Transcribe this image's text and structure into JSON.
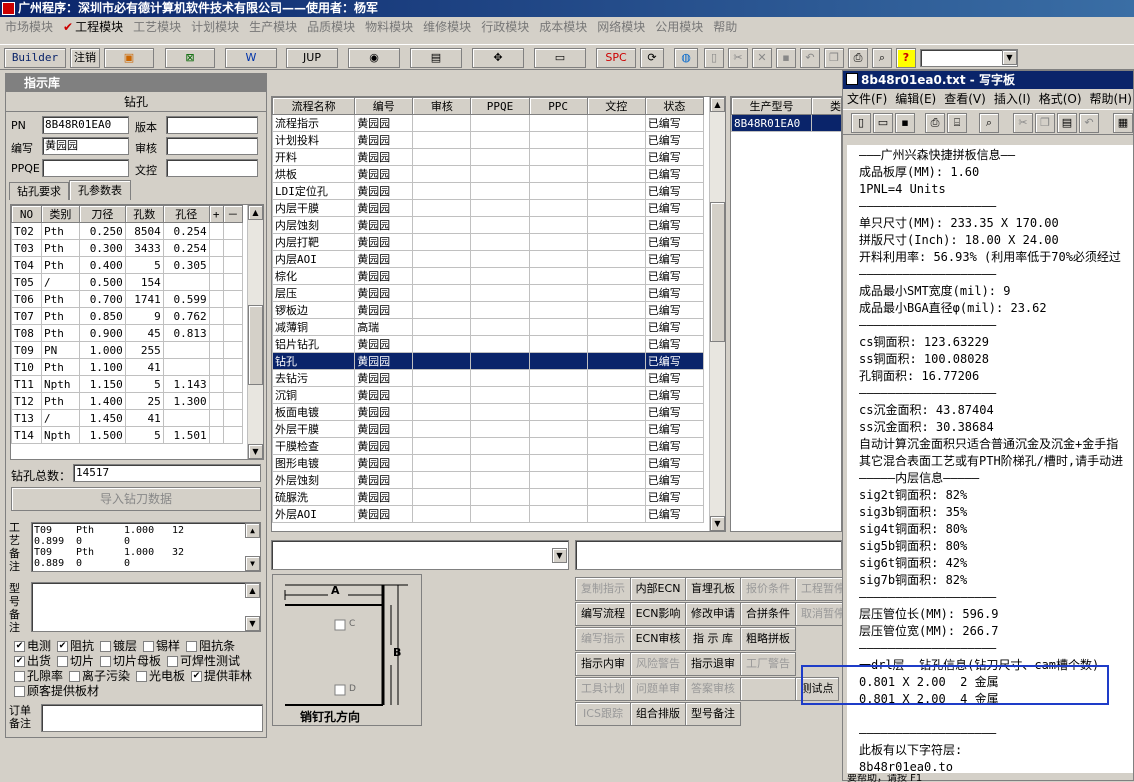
{
  "app": {
    "title": "广州程序：深圳市必有德计算机软件技术有限公司——使用者：杨军"
  },
  "menu": [
    {
      "label": "市场模块",
      "active": false
    },
    {
      "label": "工程模块",
      "active": true
    },
    {
      "label": "工艺模块",
      "active": false
    },
    {
      "label": "计划模块",
      "active": false
    },
    {
      "label": "生产模块",
      "active": false
    },
    {
      "label": "品质模块",
      "active": false
    },
    {
      "label": "物料模块",
      "active": false
    },
    {
      "label": "维修模块",
      "active": false
    },
    {
      "label": "行政模块",
      "active": false
    },
    {
      "label": "成本模块",
      "active": false
    },
    {
      "label": "网络模块",
      "active": false
    },
    {
      "label": "公用模块",
      "active": false
    },
    {
      "label": "帮助",
      "active": false
    }
  ],
  "toolbar": {
    "builder": "Builder",
    "logout": "注销",
    "jup": "JUP",
    "spc": "SPC"
  },
  "left": {
    "title": "指示库",
    "section": "钻孔",
    "pn_label": "PN",
    "pn": "8B48R01EA0",
    "version_label": "版本",
    "version": "",
    "editor_label": "编写",
    "editor": "黄园园",
    "review_label": "审核",
    "review": "",
    "ppqe_label": "PPQE",
    "ppqe": "",
    "wenkong_label": "文控",
    "wenkong": "",
    "tabs": [
      "钻孔要求",
      "孔参数表"
    ],
    "drill_headers": [
      "NO",
      "类别",
      "刀径",
      "孔数",
      "孔径",
      "+",
      "－"
    ],
    "drill_rows": [
      [
        "T02",
        "Pth",
        "0.250",
        "8504",
        "0.254"
      ],
      [
        "T03",
        "Pth",
        "0.300",
        "3433",
        "0.254"
      ],
      [
        "T04",
        "Pth",
        "0.400",
        "5",
        "0.305"
      ],
      [
        "T05",
        "/",
        "0.500",
        "154",
        ""
      ],
      [
        "T06",
        "Pth",
        "0.700",
        "1741",
        "0.599"
      ],
      [
        "T07",
        "Pth",
        "0.850",
        "9",
        "0.762"
      ],
      [
        "T08",
        "Pth",
        "0.900",
        "45",
        "0.813"
      ],
      [
        "T09",
        "PN",
        "1.000",
        "255",
        ""
      ],
      [
        "T10",
        "Pth",
        "1.100",
        "41",
        ""
      ],
      [
        "T11",
        "Npth",
        "1.150",
        "5",
        "1.143"
      ],
      [
        "T12",
        "Pth",
        "1.400",
        "25",
        "1.300"
      ],
      [
        "T13",
        "/",
        "1.450",
        "41",
        ""
      ],
      [
        "T14",
        "Npth",
        "1.500",
        "5",
        "1.501"
      ]
    ],
    "total_label": "钻孔总数：",
    "total": "14517",
    "import_btn": "导入钻刀数据",
    "note_label": "工艺备注",
    "note_lines": [
      [
        "T09",
        "Pth",
        "1.000",
        "12"
      ],
      [
        "0.899",
        "0",
        "0",
        ""
      ],
      [
        "T09",
        "Pth",
        "1.000",
        "32"
      ],
      [
        "0.889",
        "0",
        "0",
        ""
      ]
    ],
    "model_note_label": "型号备注",
    "checks": [
      [
        {
          "label": "电测",
          "checked": true
        },
        {
          "label": "阻抗",
          "checked": true
        },
        {
          "label": "镀层",
          "checked": false
        },
        {
          "label": "锡样",
          "checked": false
        },
        {
          "label": "阻抗条",
          "checked": false
        }
      ],
      [
        {
          "label": "出货",
          "checked": true
        },
        {
          "label": "切片",
          "checked": false
        },
        {
          "label": "切片母板",
          "checked": false
        },
        {
          "label": "可焊性测试",
          "checked": false
        }
      ],
      [
        {
          "label": "孔隙率",
          "checked": false
        },
        {
          "label": "离子污染",
          "checked": false
        },
        {
          "label": "光电板",
          "checked": false
        },
        {
          "label": "提供菲林",
          "checked": true
        }
      ],
      [
        {
          "label": "顾客提供板材",
          "checked": false
        }
      ]
    ],
    "order_note_label": "订单备注"
  },
  "process": {
    "headers": [
      "流程名称",
      "编号",
      "审核",
      "PPQE",
      "PPC",
      "文控",
      "状态"
    ],
    "rows": [
      [
        "流程指示",
        "黄园园",
        "",
        "",
        "",
        "",
        "已编写"
      ],
      [
        "计划投料",
        "黄园园",
        "",
        "",
        "",
        "",
        "已编写"
      ],
      [
        "开料",
        "黄园园",
        "",
        "",
        "",
        "",
        "已编写"
      ],
      [
        "烘板",
        "黄园园",
        "",
        "",
        "",
        "",
        "已编写"
      ],
      [
        "LDI定位孔",
        "黄园园",
        "",
        "",
        "",
        "",
        "已编写"
      ],
      [
        "内层干膜",
        "黄园园",
        "",
        "",
        "",
        "",
        "已编写"
      ],
      [
        "内层蚀刻",
        "黄园园",
        "",
        "",
        "",
        "",
        "已编写"
      ],
      [
        "内层打靶",
        "黄园园",
        "",
        "",
        "",
        "",
        "已编写"
      ],
      [
        "内层AOI",
        "黄园园",
        "",
        "",
        "",
        "",
        "已编写"
      ],
      [
        "棕化",
        "黄园园",
        "",
        "",
        "",
        "",
        "已编写"
      ],
      [
        "层压",
        "黄园园",
        "",
        "",
        "",
        "",
        "已编写"
      ],
      [
        "锣板边",
        "黄园园",
        "",
        "",
        "",
        "",
        "已编写"
      ],
      [
        "减薄铜",
        "高瑞",
        "",
        "",
        "",
        "",
        "已编写"
      ],
      [
        "铝片钻孔",
        "黄园园",
        "",
        "",
        "",
        "",
        "已编写"
      ],
      [
        "钻孔",
        "黄园园",
        "",
        "",
        "",
        "",
        "已编写"
      ],
      [
        "去钻污",
        "黄园园",
        "",
        "",
        "",
        "",
        "已编写"
      ],
      [
        "沉铜",
        "黄园园",
        "",
        "",
        "",
        "",
        "已编写"
      ],
      [
        "板面电镀",
        "黄园园",
        "",
        "",
        "",
        "",
        "已编写"
      ],
      [
        "外层干膜",
        "黄园园",
        "",
        "",
        "",
        "",
        "已编写"
      ],
      [
        "干膜检查",
        "黄园园",
        "",
        "",
        "",
        "",
        "已编写"
      ],
      [
        "图形电镀",
        "黄园园",
        "",
        "",
        "",
        "",
        "已编写"
      ],
      [
        "外层蚀刻",
        "黄园园",
        "",
        "",
        "",
        "",
        "已编写"
      ],
      [
        "硫脲洗",
        "黄园园",
        "",
        "",
        "",
        "",
        "已编写"
      ],
      [
        "外层AOI",
        "黄园园",
        "",
        "",
        "",
        "",
        "已编写"
      ]
    ],
    "selected": 14
  },
  "model": {
    "headers": [
      "生产型号",
      "类型"
    ],
    "value": "8B48R01EA0"
  },
  "pin": {
    "a": "A",
    "b": "B",
    "c": "C",
    "d": "D",
    "label": "销钉孔方向"
  },
  "buttons": [
    [
      {
        "label": "复制指示",
        "enabled": false
      },
      {
        "label": "内部ECN",
        "enabled": true
      },
      {
        "label": "盲埋孔板",
        "enabled": true
      },
      {
        "label": "报价条件",
        "enabled": false
      },
      {
        "label": "工程暂停",
        "enabled": false
      }
    ],
    [
      {
        "label": "编写流程",
        "enabled": true
      },
      {
        "label": "ECN影响",
        "enabled": true
      },
      {
        "label": "修改申请",
        "enabled": true
      },
      {
        "label": "合拼条件",
        "enabled": true
      },
      {
        "label": "取消暂停",
        "enabled": false
      }
    ],
    [
      {
        "label": "编写指示",
        "enabled": false
      },
      {
        "label": "ECN审核",
        "enabled": true
      },
      {
        "label": "指 示 库",
        "enabled": true
      },
      {
        "label": "粗略拼板",
        "enabled": true
      }
    ],
    [
      {
        "label": "指示内审",
        "enabled": true
      },
      {
        "label": "风险警告",
        "enabled": false
      },
      {
        "label": "指示退审",
        "enabled": true
      },
      {
        "label": "工厂警告",
        "enabled": false
      }
    ],
    [
      {
        "label": "工具计划",
        "enabled": false
      },
      {
        "label": "问题单审核",
        "enabled": false
      },
      {
        "label": "答案审核",
        "enabled": false
      },
      {
        "label": "",
        "enabled": false
      },
      {
        "label": "测试点",
        "enabled": true
      }
    ],
    [
      {
        "label": "ICS跟踪",
        "enabled": false
      },
      {
        "label": "组合排版",
        "enabled": true
      },
      {
        "label": "型号备注",
        "enabled": true
      }
    ]
  ],
  "notepad": {
    "title": "8b48r01ea0.txt - 写字板",
    "menu": [
      "文件(F)",
      "编辑(E)",
      "查看(V)",
      "插入(I)",
      "格式(O)",
      "帮助(H)"
    ],
    "lines": [
      "———广州兴森快捷拼板信息——",
      "成品板厚(MM): 1.60",
      "1PNL=4 Units",
      "———————————————————",
      "单只尺寸(MM): 233.35 X 170.00",
      "拼版尺寸(Inch): 18.00 X 24.00",
      "开料利用率: 56.93% (利用率低于70%必须经过",
      "———————————————————",
      "成品最小SMT宽度(mil): 9",
      "成品最小BGA直径φ(mil): 23.62",
      "———————————————————",
      "cs铜面积: 123.63229",
      "ss铜面积: 100.08028",
      "孔铜面积: 16.77206",
      "———————————————————",
      "cs沉金面积: 43.87404",
      "ss沉金面积: 30.38684",
      "自动计算沉金面积只适合普通沉金及沉金+金手指",
      "其它混合表面工艺或有PTH阶梯孔/槽时,请手动进",
      "—————内层信息—————",
      "sig2t铜面积: 82%",
      "sig3b铜面积: 35%",
      "sig4t铜面积: 80%",
      "sig5b铜面积: 80%",
      "sig6t铜面积: 42%",
      "sig7b铜面积: 82%",
      "———————————————————",
      "层压管位长(MM): 596.9",
      "层压管位宽(MM): 266.7",
      "———————————————————",
      "一drl层  钻孔信息(钻刀尺寸、cam槽个数)",
      "0.801 X 2.00  2 金属",
      "0.801 X 2.00  4 金属",
      "",
      "———————————————————",
      "此板有以下字符层:",
      "8b48r01ea0.to"
    ],
    "status": "要帮助，请按 F1"
  }
}
